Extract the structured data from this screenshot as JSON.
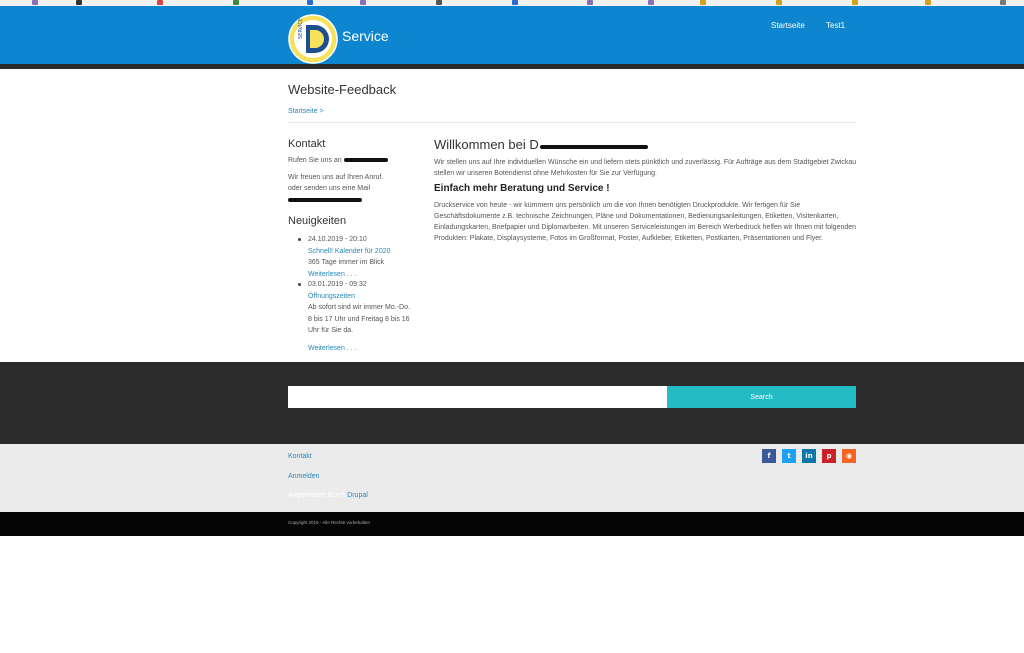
{
  "header": {
    "site_name": "Service",
    "logo_text": "SERVICE",
    "logo_letter": "D",
    "nav": [
      "Startseite",
      "Test1"
    ]
  },
  "page": {
    "title": "Website-Feedback",
    "breadcrumb": "Startseite >"
  },
  "sidebar": {
    "contact_heading": "Kontakt",
    "contact_line1": "Rufen Sie uns an",
    "contact_line2": "Wir freuen uns auf Ihren Anruf.",
    "contact_line3": "oder senden uns eine Mail",
    "news_heading": "Neuigkeiten",
    "news": [
      {
        "date": "24.10.2019 - 20:10",
        "title": "Schnell! Kalender für 2020",
        "body": "365 Tage immer im Blick",
        "more": "Weiterlesen . . ."
      },
      {
        "date": "03.01.2019 - 09:32",
        "title": "Öffnungszeiten",
        "body": "Ab sofort sind wir immer Mo.-Do. 8 bis 17 Uhr und Freitag 8 bis 16 Uhr für Sie da.",
        "more": "Weiterlesen . . ."
      }
    ]
  },
  "main": {
    "heading": "Willkommen bei D",
    "intro": "Wir stellen uns auf Ihre individuellen Wünsche ein und liefern stets pünktlich und zuverlässig. Für Aufträge aus dem Stadtgebiet Zwickau stellen wir unseren Botendienst ohne Mehrkosten für Sie zur Verfügung.",
    "subheading": "Einfach mehr Beratung und Service !",
    "body": "Druckservice von heute - wir kümmern uns persönlich um die von Ihnen benötigten Druckprodukte. Wir fertigen für Sie Geschäftsdokumente z.B. technische Zeichnungen, Pläne und Dokumentationen, Bedienungsanleitungen, Etiketten, Visitenkarten, Einladungskarten, Briefpapier und Diplomarbeiten. Mit unseren Serviceleistungen im Bereich Werbedruck helfen wir Ihnen mit folgenden Produkten: Plakate, Displaysysteme, Fotos im Großformat, Poster, Aufkleber, Etiketten, Postkarten, Präsentationen und Flyer."
  },
  "search": {
    "placeholder": "",
    "button_label": "Search"
  },
  "footer": {
    "links": [
      "Kontakt",
      "Anmelden"
    ],
    "powered_prefix": "Angetrieben durch",
    "powered_link": "Drupal",
    "social": [
      {
        "icon": "facebook-icon",
        "glyph": "f",
        "color": "#3b5998"
      },
      {
        "icon": "twitter-icon",
        "glyph": "t",
        "color": "#1da1f2"
      },
      {
        "icon": "linkedin-icon",
        "glyph": "in",
        "color": "#0e76a8"
      },
      {
        "icon": "pinterest-icon",
        "glyph": "p",
        "color": "#cb2027"
      },
      {
        "icon": "rss-icon",
        "glyph": "◉",
        "color": "#f26522"
      }
    ],
    "copyright": "Copyright 2019 - Alle Rechte vorbehalten"
  }
}
